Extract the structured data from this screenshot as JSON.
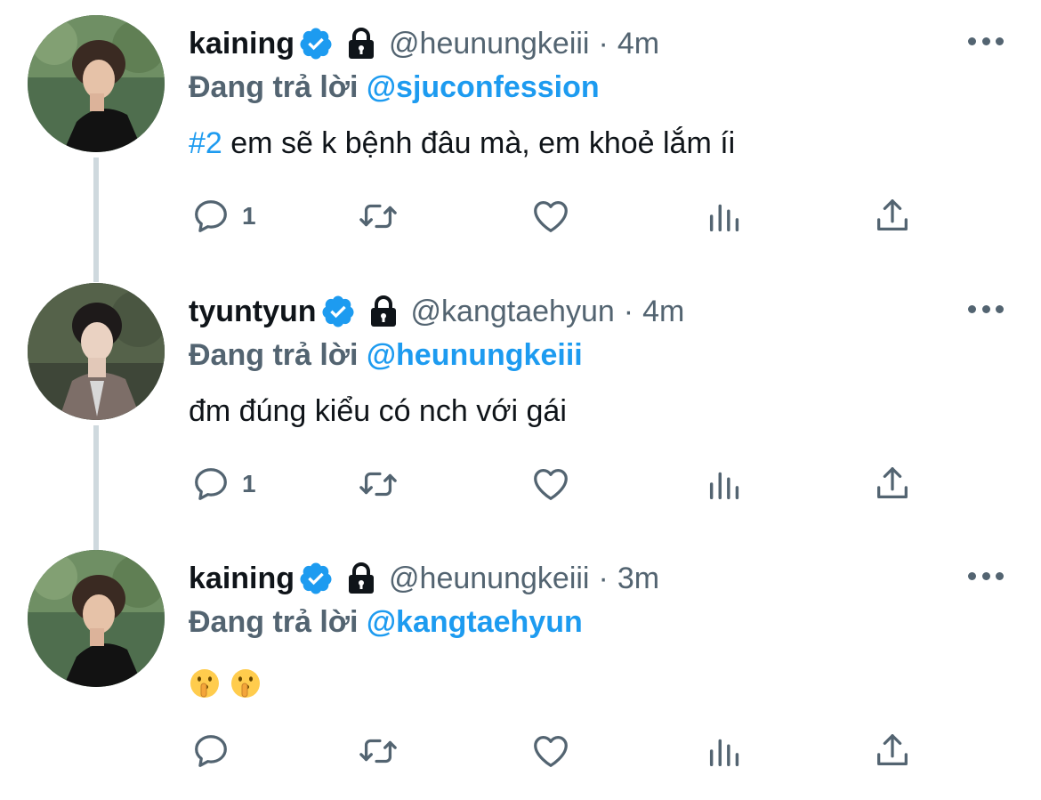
{
  "thread": {
    "tweets": [
      {
        "display_name": "kaining",
        "handle": "@heunungkeiii",
        "separator": "·",
        "time": "4m",
        "reply_prefix": "Đang trả lời",
        "reply_to": "@sjuconfession",
        "hashtag": "#2",
        "text": " em sẽ k bệnh đâu mà, em khoẻ lắm íi",
        "reply_count": "1"
      },
      {
        "display_name": "tyuntyun",
        "handle": "@kangtaehyun",
        "separator": "·",
        "time": "4m",
        "reply_prefix": "Đang trả lời",
        "reply_to": "@heunungkeiii",
        "text": "đm đúng kiểu có nch với gái",
        "reply_count": "1"
      },
      {
        "display_name": "kaining",
        "handle": "@heunungkeiii",
        "separator": "·",
        "time": "3m",
        "reply_prefix": "Đang trả lời",
        "reply_to": "@kangtaehyun",
        "emojis": [
          "shushing-face-emoji",
          "shushing-face-emoji"
        ],
        "reply_count": ""
      }
    ]
  },
  "icons": [
    "verified-badge-icon",
    "lock-icon",
    "more-icon",
    "reply-icon",
    "retweet-icon",
    "like-icon",
    "views-icon",
    "share-icon"
  ],
  "colors": {
    "accent": "#1d9bf0",
    "secondary_text": "#536471",
    "primary_text": "#0f1419",
    "thread_line": "#cfd9de"
  }
}
